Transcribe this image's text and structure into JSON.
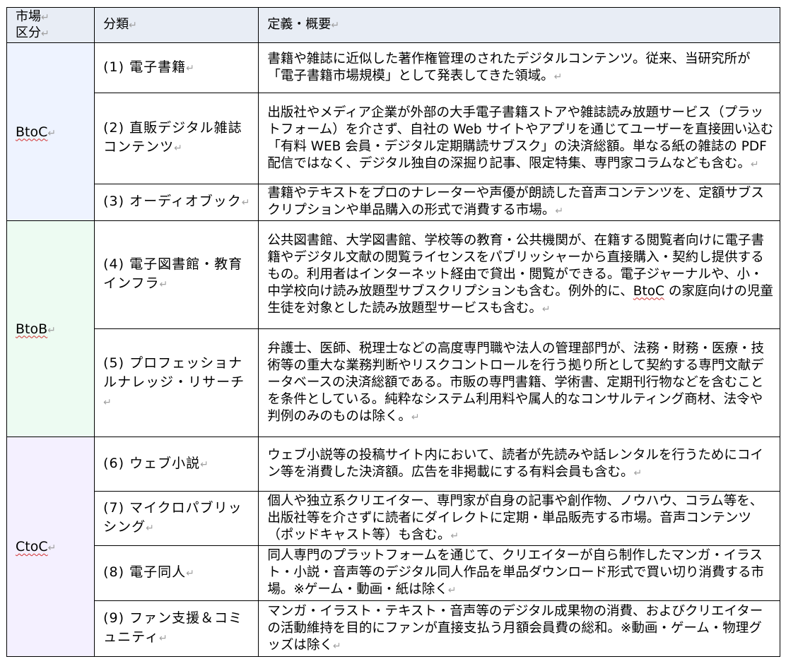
{
  "header": {
    "market_line1": "市場",
    "market_line2": "区分",
    "category": "分類",
    "definition": "定義・概要"
  },
  "para_mark": "↵",
  "markets": [
    {
      "name": "BtoC",
      "color": "#eef3ff"
    },
    {
      "name": "BtoB",
      "color": "#edfbf2"
    },
    {
      "name": "CtoC",
      "color": "#f4f0ff"
    }
  ],
  "rows": [
    {
      "category": "(1) 電子書籍",
      "definition": "書籍や雑誌に近似した著作権管理のされたデジタルコンテンツ。従来、当研究所が「電子書籍市場規模」として発表してきた領域。"
    },
    {
      "category": "(2) 直販デジタル雑誌コンテンツ",
      "definition": "出版社やメディア企業が外部の大手電子書籍ストアや雑誌読み放題サービス（プラットフォーム）を介さず、自社の Web サイトやアプリを通じてユーザーを直接囲い込む「有料 WEB 会員・デジタル定期購読サブスク」の決済総額。単なる紙の雑誌の PDF 配信ではなく、デジタル独自の深掘り記事、限定特集、専門家コラムなども含む。"
    },
    {
      "category": "(3) オーディオブック",
      "definition": "書籍やテキストをプロのナレーターや声優が朗読した音声コンテンツを、定額サブスクリプションや単品購入の形式で消費する市場。"
    },
    {
      "category": "(4) 電子図書館・教育インフラ",
      "definition_pre": "公共図書館、大学図書館、学校等の教育・公共機関が、在籍する閲覧者向けに電子書籍やデジタル文献の閲覧ライセンスをパブリッシャーから直接購入・契約し提供するもの。利用者はインターネット経由で貸出・閲覧ができる。電子ジャーナルや、小・中学校向け読み放題型サブスクリプションも含む。例外的に、",
      "definition_term": "BtoC",
      "definition_post": " の家庭向けの児童生徒を対象とした読み放題型サービスも含む。"
    },
    {
      "category": "(5) プロフェッショナルナレッジ・リサーチ",
      "definition": "弁護士、医師、税理士などの高度専門職や法人の管理部門が、法務・財務・医療・技術等の重大な業務判断やリスクコントロールを行う拠り所として契約する専門文献データベースの決済総額である。市販の専門書籍、学術書、定期刊行物などを含むことを条件としている。純粋なシステム利用料や属人的なコンサルティング商材、法令や判例のみのものは除く。"
    },
    {
      "category": "(6) ウェブ小説",
      "definition": "ウェブ小説等の投稿サイト内において、読者が先読みや話レンタルを行うためにコイン等を消費した決済額。広告を非掲載にする有料会員も含む。"
    },
    {
      "category": "(7) マイクロパブリッシング",
      "definition": "個人や独立系クリエイター、専門家が自身の記事や創作物、ノウハウ、コラム等を、出版社等を介さずに読者にダイレクトに定期・単品販売する市場。音声コンテンツ（ポッドキャスト等）も含む。"
    },
    {
      "category": "(8) 電子同人",
      "definition": "同人専門のプラットフォームを通じて、クリエイターが自ら制作したマンガ・イラスト・小説・音声等のデジタル同人作品を単品ダウンロード形式で買い切り消費する市場。※ゲーム・動画・紙は除く"
    },
    {
      "category": "(9) ファン支援＆コミュニティ",
      "definition": "マンガ・イラスト・テキスト・音声等のデジタル成果物の消費、およびクリエイターの活動維持を目的にファンが直接支払う月額会員費の総和。※動画・ゲーム・物理グッズは除く"
    }
  ]
}
